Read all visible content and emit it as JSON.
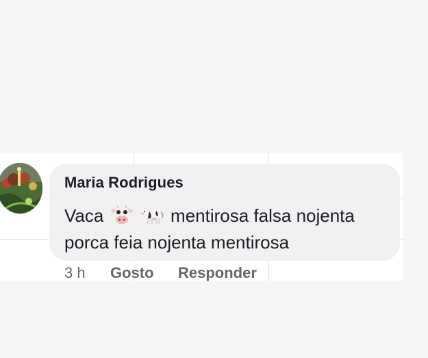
{
  "comment": {
    "author": "Maria Rodrigues",
    "text_line1_before_emoji": "Vaca",
    "emoji": [
      "cow-face-icon",
      "cow-icon"
    ],
    "text_line1_after_emoji": "mentirosa falsa nojenta",
    "text_line2": "porca feia nojenta mentirosa",
    "timestamp": "3 h",
    "like_label": "Gosto",
    "reply_label": "Responder"
  },
  "colors": {
    "page_background": "#f6f6f7",
    "bubble_background": "#f0f1f3",
    "text": "#1c1e21",
    "secondary_text": "#65676b"
  }
}
